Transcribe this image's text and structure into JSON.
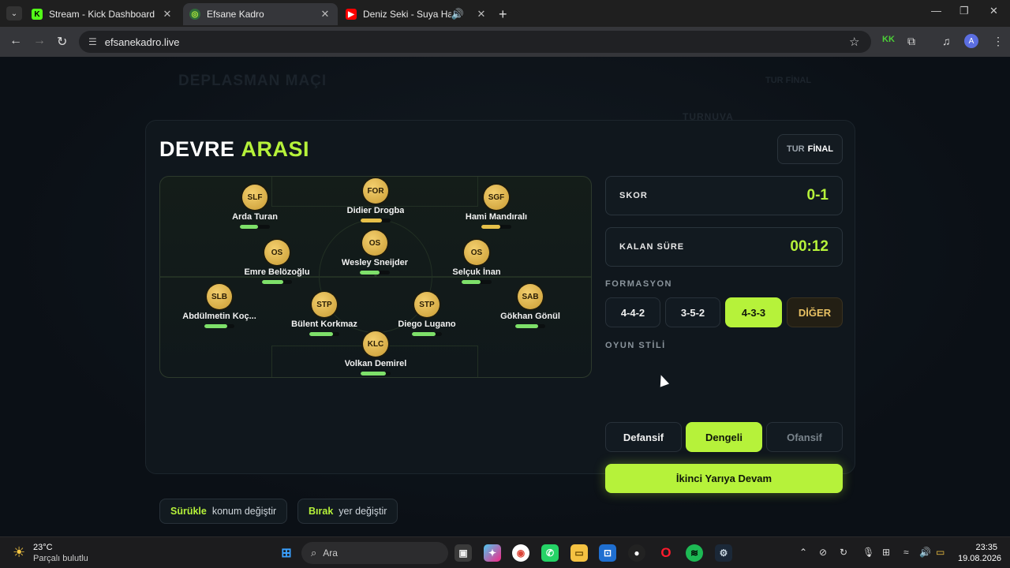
{
  "browser": {
    "tabs": [
      {
        "title": "Stream - Kick Dashboard",
        "icon": "kick-icon",
        "active": false
      },
      {
        "title": "Efsane Kadro",
        "icon": "efsane-icon",
        "active": true
      },
      {
        "title": "Deniz Seki - Suya Hapsettim",
        "icon": "youtube-icon",
        "active": false
      }
    ],
    "url": "efsanekadro.live",
    "profile_initial": "A"
  },
  "background": {
    "title": "DEPLASMAN MAÇI",
    "tur": "TUR FİNAL",
    "turnuva": "TURNUVA"
  },
  "modal": {
    "title_part1": "DEVRE",
    "title_part2": "ARASI",
    "tur_label": "TUR",
    "tur_value": "FİNAL",
    "score_label": "SKOR",
    "score_value": "0-1",
    "time_label": "KALAN SÜRE",
    "time_value": "00:12",
    "formation_label": "FORMASYON",
    "formations": [
      {
        "label": "4-4-2",
        "selected": false
      },
      {
        "label": "3-5-2",
        "selected": false
      },
      {
        "label": "4-3-3",
        "selected": true
      },
      {
        "label": "DİĞER",
        "selected": false
      }
    ],
    "style_label": "OYUN STİLİ",
    "styles": [
      {
        "label": "Defansif",
        "selected": false
      },
      {
        "label": "Dengeli",
        "selected": true
      },
      {
        "label": "Ofansif",
        "selected": false
      }
    ],
    "continue_label": "İkinci Yarıya Devam",
    "hints": [
      {
        "key": "Sürükle",
        "desc": "konum değiştir"
      },
      {
        "key": "Bırak",
        "desc": "yer değiştir"
      }
    ]
  },
  "players": [
    {
      "pos": "FOR",
      "name": "Didier Drogba",
      "stamina": 0.72,
      "bar_color": "#e6c04a"
    },
    {
      "pos": "SLF",
      "name": "Arda Turan",
      "stamina": 0.6,
      "bar_color": "#7ee06a"
    },
    {
      "pos": "SGF",
      "name": "Hami Mandıralı",
      "stamina": 0.62,
      "bar_color": "#e6c04a"
    },
    {
      "pos": "OS",
      "name": "Wesley Sneijder",
      "stamina": 0.65,
      "bar_color": "#7ee06a"
    },
    {
      "pos": "OS",
      "name": "Emre Belözoğlu",
      "stamina": 0.7,
      "bar_color": "#7ee06a"
    },
    {
      "pos": "OS",
      "name": "Selçuk İnan",
      "stamina": 0.62,
      "bar_color": "#7ee06a"
    },
    {
      "pos": "SLB",
      "name": "Abdülmetin Koç...",
      "stamina": 0.75,
      "bar_color": "#7ee06a"
    },
    {
      "pos": "STP",
      "name": "Bülent Korkmaz",
      "stamina": 0.8,
      "bar_color": "#7ee06a"
    },
    {
      "pos": "STP",
      "name": "Diego Lugano",
      "stamina": 0.8,
      "bar_color": "#7ee06a"
    },
    {
      "pos": "SAB",
      "name": "Gökhan Gönül",
      "stamina": 0.75,
      "bar_color": "#7ee06a"
    },
    {
      "pos": "KLC",
      "name": "Volkan Demirel",
      "stamina": 0.85,
      "bar_color": "#7ee06a"
    }
  ],
  "taskbar": {
    "temperature": "23°C",
    "condition": "Parçalı bulutlu",
    "search_placeholder": "Ara",
    "time": "23:35",
    "date": "19.08.2026"
  }
}
